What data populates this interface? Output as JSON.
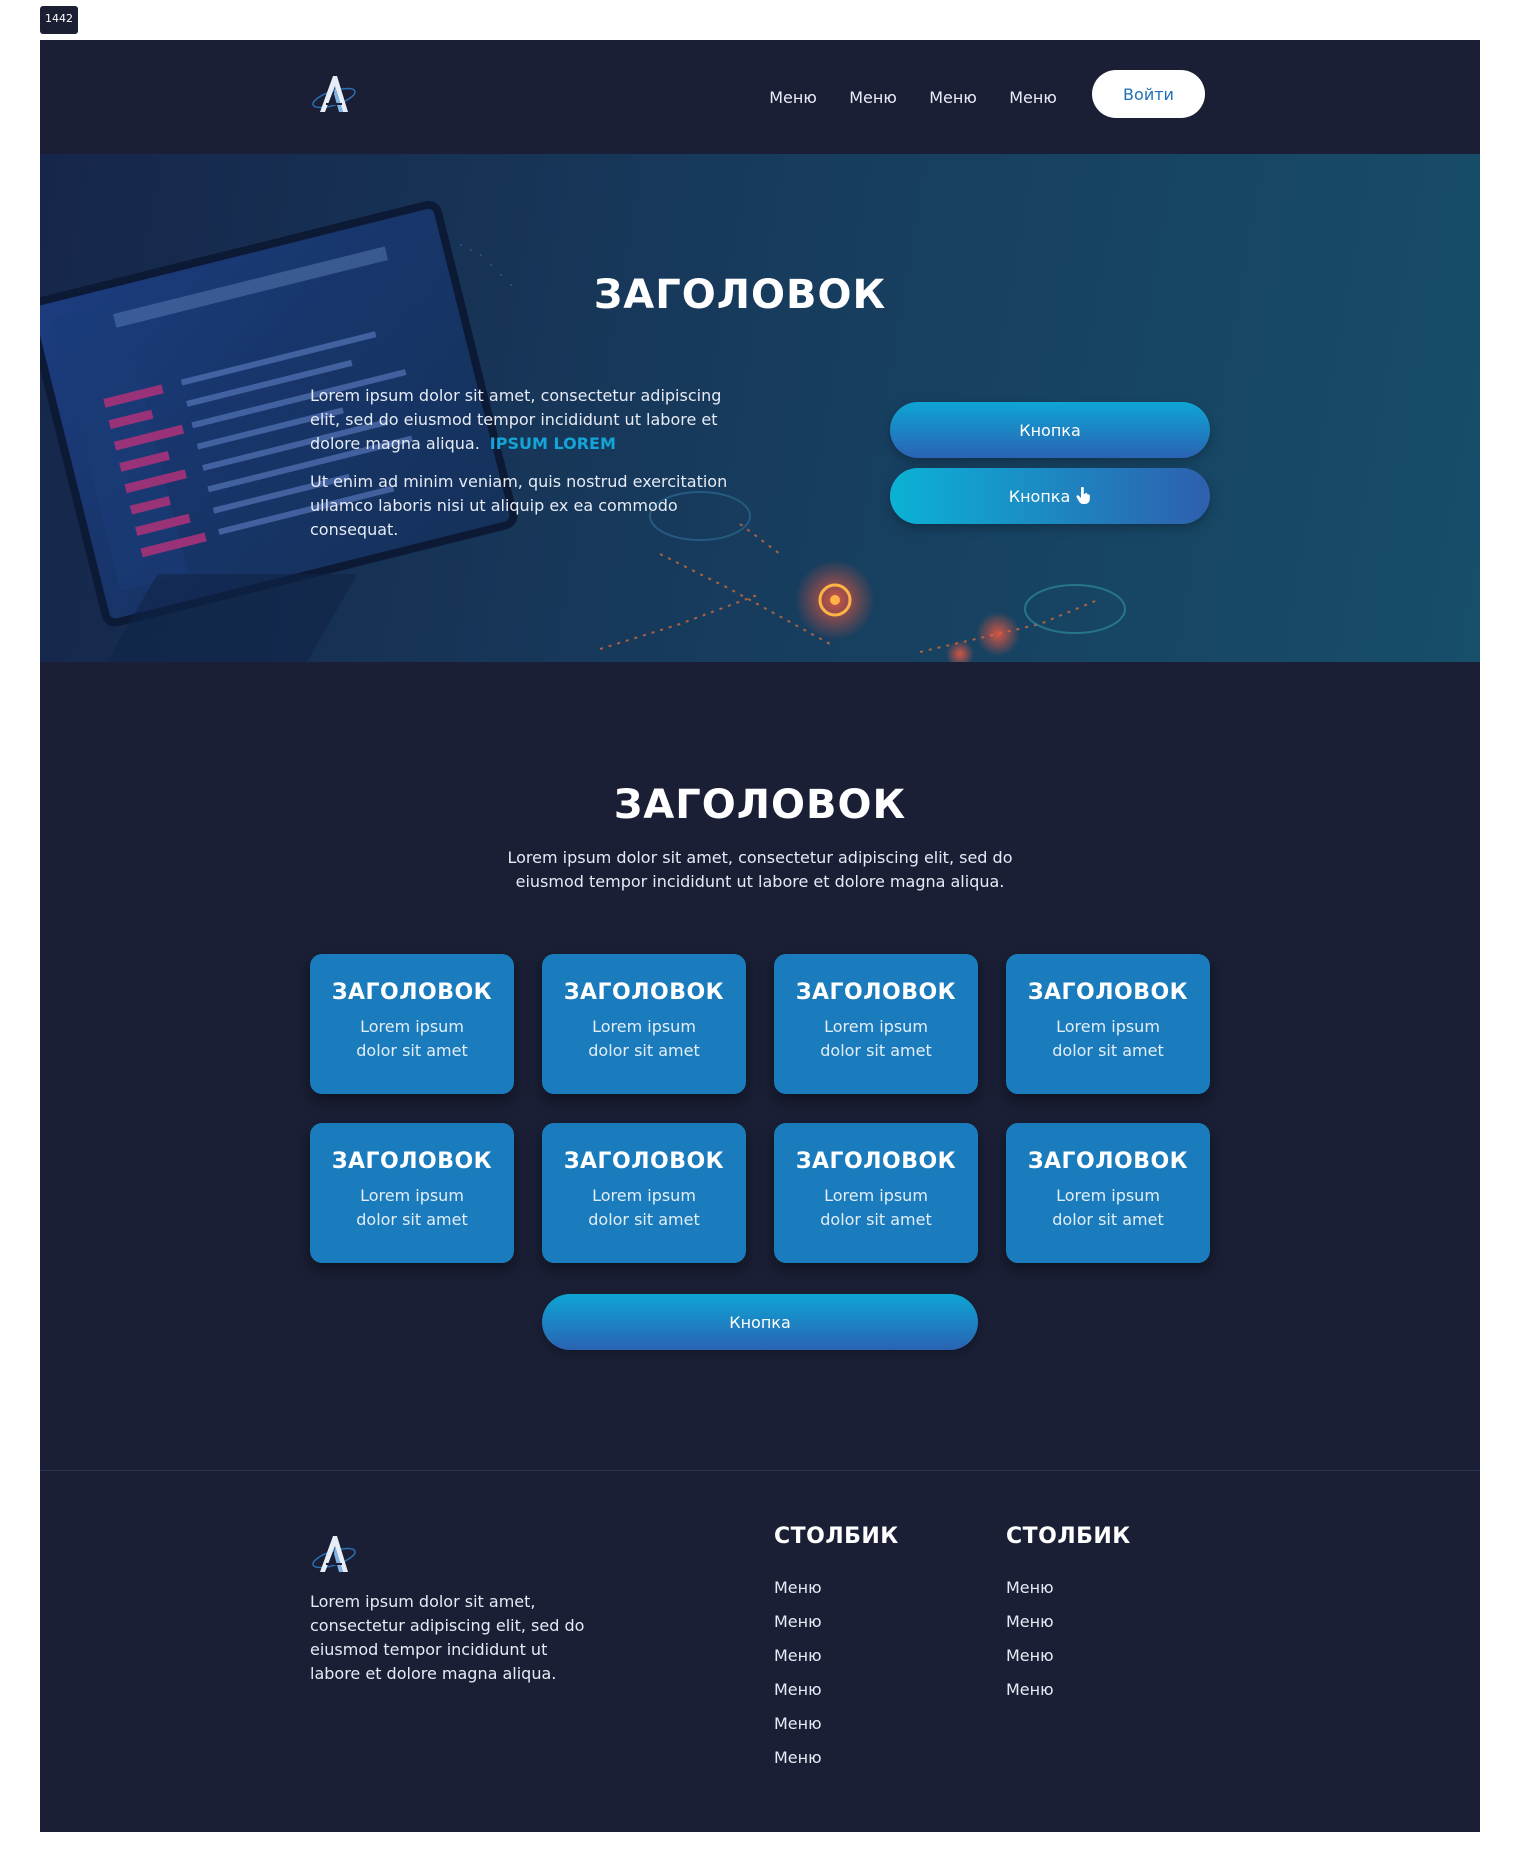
{
  "frame_label": "1442",
  "header": {
    "nav": [
      "Меню",
      "Меню",
      "Меню",
      "Меню"
    ],
    "login_label": "Войти"
  },
  "hero": {
    "title": "ЗАГОЛОВОК",
    "paragraph1": "Lorem ipsum dolor sit amet, consectetur adipiscing elit, sed do eiusmod tempor incididunt ut labore et dolore magna aliqua.",
    "accent": "IPSUM LOREM",
    "paragraph2": "Ut enim ad minim veniam, quis nostrud exercitation ullamco laboris nisi ut aliquip ex ea commodo consequat.",
    "button1": "Кнопка",
    "button2": "Кнопка"
  },
  "features": {
    "title": "ЗАГОЛОВОК",
    "description": "Lorem ipsum dolor sit amet, consectetur adipiscing elit, sed do eiusmod tempor incididunt ut labore et dolore magna aliqua.",
    "cards": [
      {
        "title": "ЗАГОЛОВОК",
        "text": "Lorem ipsum dolor sit amet"
      },
      {
        "title": "ЗАГОЛОВОК",
        "text": "Lorem ipsum dolor sit amet"
      },
      {
        "title": "ЗАГОЛОВОК",
        "text": "Lorem ipsum dolor sit amet"
      },
      {
        "title": "ЗАГОЛОВОК",
        "text": "Lorem ipsum dolor sit amet"
      },
      {
        "title": "ЗАГОЛОВОК",
        "text": "Lorem ipsum dolor sit amet"
      },
      {
        "title": "ЗАГОЛОВОК",
        "text": "Lorem ipsum dolor sit amet"
      },
      {
        "title": "ЗАГОЛОВОК",
        "text": "Lorem ipsum dolor sit amet"
      },
      {
        "title": "ЗАГОЛОВОК",
        "text": "Lorem ipsum dolor sit amet"
      }
    ],
    "button": "Кнопка"
  },
  "footer": {
    "text": "Lorem ipsum dolor sit amet, consectetur adipiscing elit, sed do eiusmod tempor incididunt ut labore et dolore magna aliqua.",
    "columns": [
      {
        "title": "СТОЛБИК",
        "items": [
          "Меню",
          "Меню",
          "Меню",
          "Меню",
          "Меню",
          "Меню"
        ]
      },
      {
        "title": "СТОЛБИК",
        "items": [
          "Меню",
          "Меню",
          "Меню",
          "Меню"
        ]
      }
    ]
  },
  "colors": {
    "background": "#1a1f36",
    "accent": "#14a5d8",
    "card": "#1a7cbd",
    "button_gradient_start": "#0ea5d4",
    "button_gradient_end": "#2a63b3"
  },
  "icons": [
    "logo-icon",
    "hand-pointer-icon"
  ]
}
